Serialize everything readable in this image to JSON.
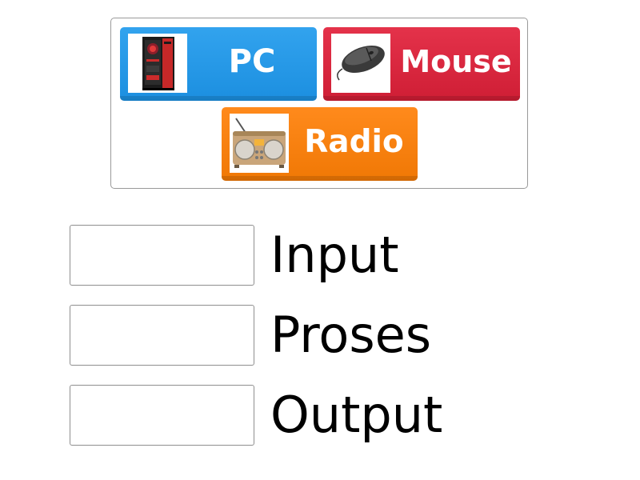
{
  "cards": {
    "pc": {
      "label": "PC",
      "image_icon": "gaming-pc-tower-icon",
      "color": "#2196e8"
    },
    "mouse": {
      "label": "Mouse",
      "image_icon": "computer-mouse-icon",
      "color": "#d8253d"
    },
    "radio": {
      "label": "Radio",
      "image_icon": "radio-icon",
      "color": "#f57f0e"
    }
  },
  "targets": [
    {
      "label": "Input",
      "value": ""
    },
    {
      "label": "Proses",
      "value": ""
    },
    {
      "label": "Output",
      "value": ""
    }
  ]
}
